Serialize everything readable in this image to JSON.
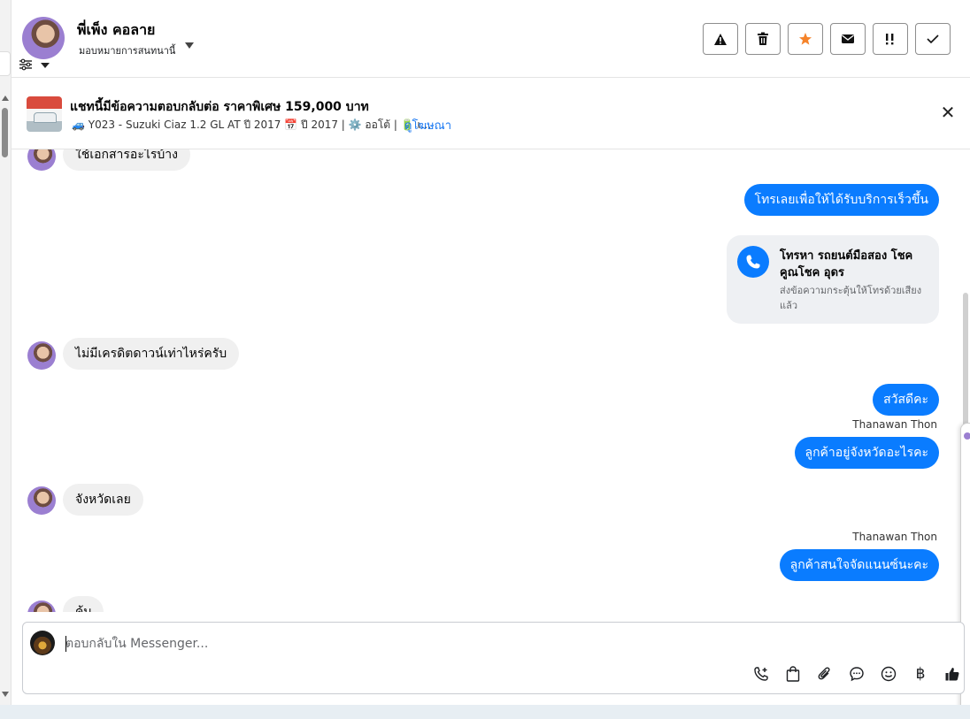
{
  "header": {
    "contact_name": "พี่เพ็ง คอลาย",
    "assign_label": "มอบหมายการสนทนานี้",
    "actions": [
      {
        "icon": "warning-icon",
        "glyph": "⚠"
      },
      {
        "icon": "trash-icon",
        "glyph": "🗑"
      },
      {
        "icon": "star-icon",
        "glyph": "★"
      },
      {
        "icon": "envelope-icon",
        "glyph": "✉"
      },
      {
        "icon": "priority-icon",
        "glyph": "!!"
      },
      {
        "icon": "check-icon",
        "glyph": "✓"
      }
    ]
  },
  "banner": {
    "title": "แชทนี้มีข้อความตอบกลับต่อ ราคาพิเศษ 159,000 บาท",
    "subtitle": "🚙 Y023 - Suzuki Ciaz 1.2 GL AT ปี 2017 📅 ปี 2017 | ⚙️ ออโต้ | 🔋 เ...",
    "link": "ดูโฆษณา",
    "close_glyph": "✕"
  },
  "messages": [
    {
      "dir": "in",
      "text": "ใช้เอกสารอะไรบ้าง"
    },
    {
      "dir": "out",
      "text": "โทรเลยเพื่อให้ได้รับบริการเร็วขึ้น"
    },
    {
      "dir": "out-card",
      "title": "โทรหา รถยนต์มือสอง โชคคูณโชค อุดร",
      "subtitle": "ส่งข้อความกระตุ้นให้โทรด้วยเสียงแล้ว"
    },
    {
      "dir": "in",
      "text": "ไม่มีเครดิตดาวน์เท่าไหร่ครับ"
    },
    {
      "dir": "out",
      "text": "สวัสดีคะ"
    },
    {
      "dir": "sender",
      "text": "Thanawan Thon"
    },
    {
      "dir": "out",
      "text": "ลูกค้าอยู่จังหวัดอะไรคะ"
    },
    {
      "dir": "in",
      "text": "จังหวัดเลย"
    },
    {
      "dir": "sender",
      "text": "Thanawan Thon"
    },
    {
      "dir": "out",
      "text": "ลูกค้าสนใจจัดแนนซ์นะคะ"
    },
    {
      "dir": "in",
      "text": "ค้บ"
    }
  ],
  "composer": {
    "placeholder": "ตอบกลับใน Messenger...",
    "tools": [
      {
        "icon": "call-add-icon",
        "glyph": "📞"
      },
      {
        "icon": "shopping-bag-icon",
        "glyph": "👜"
      },
      {
        "icon": "paperclip-icon",
        "glyph": "📎"
      },
      {
        "icon": "chat-bubble-icon",
        "glyph": "💬"
      },
      {
        "icon": "emoji-icon",
        "glyph": "☺"
      },
      {
        "icon": "baht-icon",
        "glyph": "฿"
      },
      {
        "icon": "thumbs-up-icon",
        "glyph": "👍"
      }
    ]
  },
  "colors": {
    "outgoing_bubble": "#0a7cff",
    "incoming_bubble": "#f0f0f0",
    "link": "#1877f2",
    "star": "#f5832a"
  }
}
